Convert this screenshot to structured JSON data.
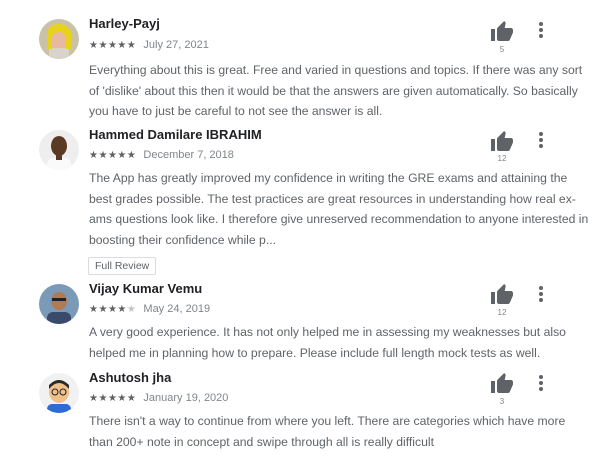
{
  "reviews": [
    {
      "author": "Harley-Payj",
      "stars": [
        "★",
        "★",
        "★",
        "★",
        "★"
      ],
      "stars_off": [],
      "rating": 5,
      "date": "July 27, 2021",
      "likes": "5",
      "text": "Everything about this is great. Free and varied in questions and topics. If there was any sort of 'dislike' about this then it would be that the answers are given automatically. So basically you have to just be careful to not see the answer is all.",
      "avatar_icon": "avatar-yellow-hair-icon"
    },
    {
      "author": "Hammed Damilare IBRAHIM",
      "stars": [
        "★",
        "★",
        "★",
        "★",
        "★"
      ],
      "stars_off": [],
      "rating": 5,
      "date": "December 7, 2018",
      "likes": "12",
      "text": "The App has greatly improved my confidence in writing the GRE exams and attaining the best grades possible. The test practices are great resources in understanding how real ex-ams questions look like. I therefore give unreserved recommendation to anyone interested in boosting their confidence while p...",
      "full_review_label": "Full Review",
      "avatar_icon": "avatar-person-icon"
    },
    {
      "author": "Vijay Kumar Vemu",
      "stars": [
        "★",
        "★",
        "★",
        "★"
      ],
      "stars_off": [
        "★"
      ],
      "rating": 4,
      "date": "May 24, 2019",
      "likes": "12",
      "text": "A very good experience. It has not only helped me in assessing my weaknesses but also helped me in planning how to prepare. Please include full length mock tests as well.",
      "avatar_icon": "avatar-person-icon"
    },
    {
      "author": "Ashutosh jha",
      "stars": [
        "★",
        "★",
        "★",
        "★",
        "★"
      ],
      "stars_off": [],
      "rating": 5,
      "date": "January 19, 2020",
      "likes": "3",
      "text": "There isn't a way to continue from where you left. There are categories which have more than 200+ note in concept and swipe through all is really difficult",
      "avatar_icon": "avatar-cartoon-icon"
    }
  ],
  "colors": {
    "thumb": "#5f6368",
    "star_on": "#616161",
    "star_off": "#c4c4c4"
  }
}
